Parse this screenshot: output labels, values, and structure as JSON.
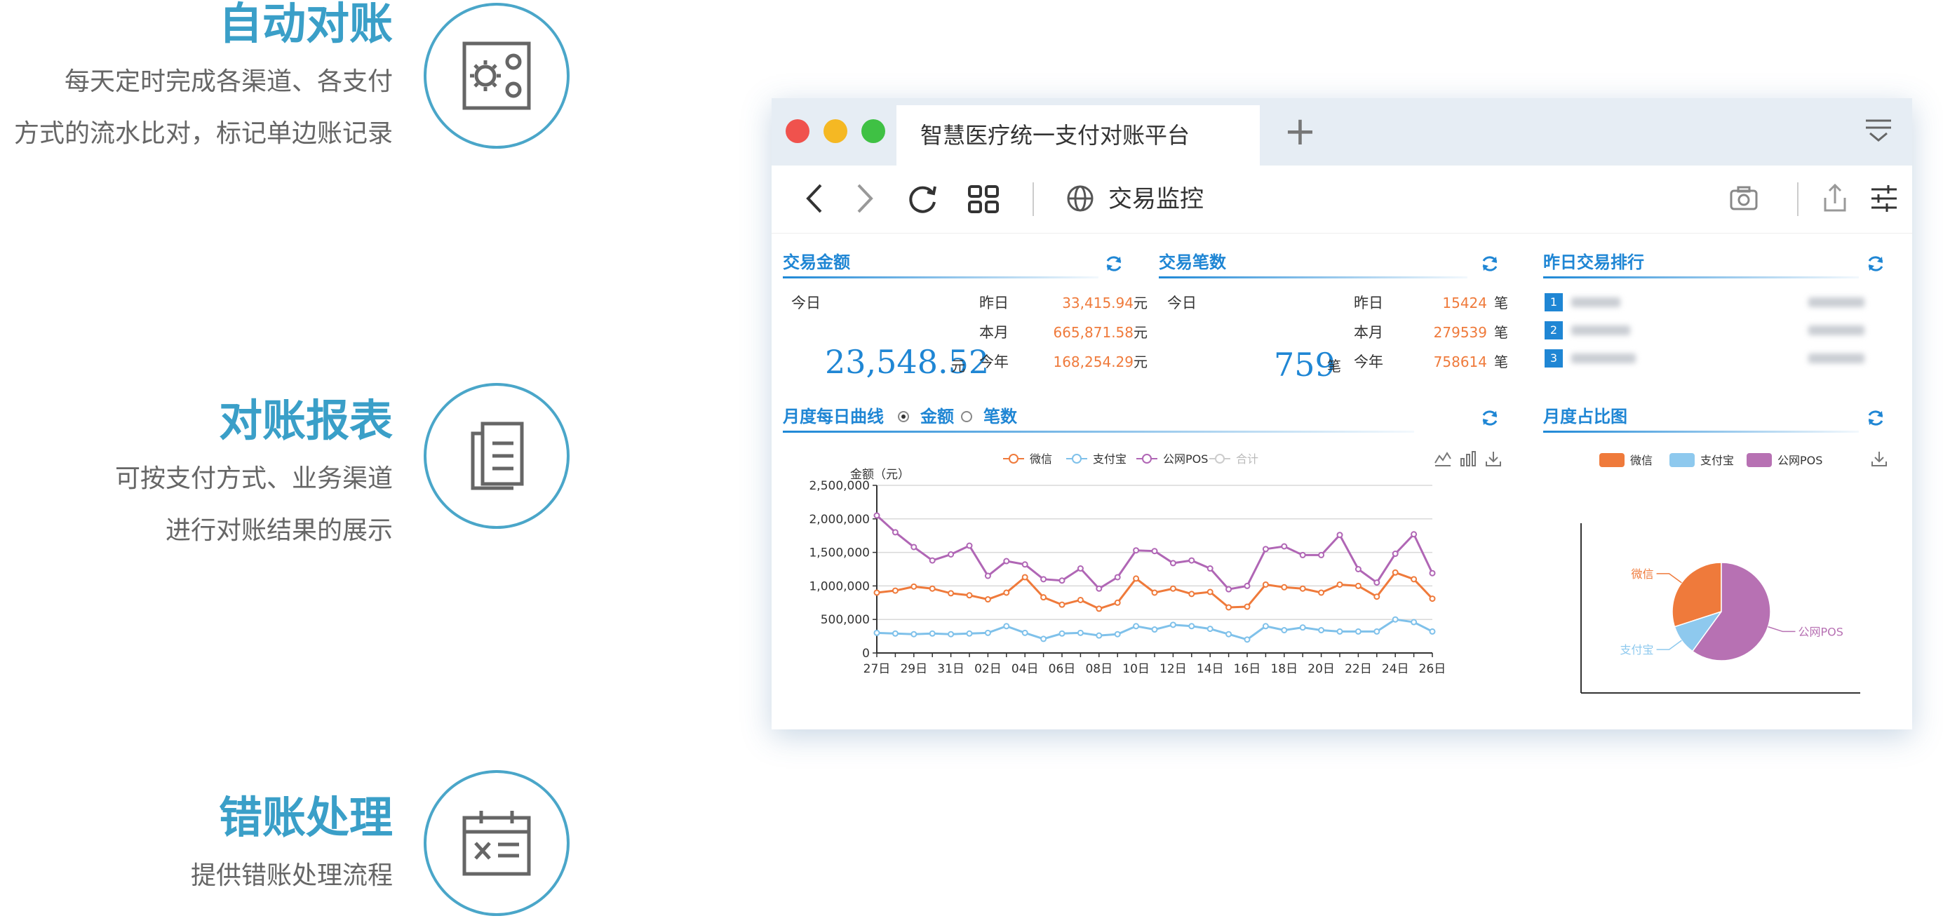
{
  "features": [
    {
      "title": "自动对账",
      "lines": [
        "每天定时完成各渠道、各支付",
        "方式的流水比对，标记单边账记录"
      ],
      "icon": "settings-panel-icon"
    },
    {
      "title": "对账报表",
      "lines": [
        "可按支付方式、业务渠道",
        "进行对账结果的展示"
      ],
      "icon": "document-icon"
    },
    {
      "title": "错账处理",
      "lines": [
        "提供错账处理流程"
      ],
      "icon": "calendar-x-icon"
    }
  ],
  "browser": {
    "tab_title": "智慧医疗统一支付对账平台",
    "new_tab": "+",
    "address": "交易监控",
    "colors": {
      "close": "#f0524d",
      "minimize": "#f5b823",
      "maximize": "#3fc144"
    }
  },
  "amount_panel": {
    "title": "交易金额",
    "today_label": "今日",
    "today_value": "23,548.52",
    "today_unit": "元",
    "rows": [
      {
        "label": "昨日",
        "value": "33,415.94",
        "unit": "元"
      },
      {
        "label": "本月",
        "value": "665,871.58",
        "unit": "元"
      },
      {
        "label": "今年",
        "value": "168,254.29",
        "unit": "元"
      }
    ]
  },
  "count_panel": {
    "title": "交易笔数",
    "today_label": "今日",
    "today_value": "759",
    "today_unit": "笔",
    "rows": [
      {
        "label": "昨日",
        "value": "15424",
        "unit": "笔"
      },
      {
        "label": "本月",
        "value": "279539",
        "unit": "笔"
      },
      {
        "label": "今年",
        "value": "758614",
        "unit": "笔"
      }
    ]
  },
  "ranking_panel": {
    "title": "昨日交易排行",
    "ranks": [
      "1",
      "2",
      "3"
    ]
  },
  "line_panel": {
    "title": "月度每日曲线",
    "radio_amount": "金额",
    "radio_count": "笔数",
    "selected": "金额"
  },
  "pie_panel": {
    "title": "月度占比图"
  },
  "chart_data": [
    {
      "type": "line",
      "ylabel": "金额（元）",
      "ylim": [
        0,
        2500000
      ],
      "yticks": [
        "0",
        "500,000",
        "1,000,000",
        "1,500,000",
        "2,000,000",
        "2,500,000"
      ],
      "x": [
        "27日",
        "28日",
        "29日",
        "30日",
        "31日",
        "01日",
        "02日",
        "03日",
        "04日",
        "05日",
        "06日",
        "07日",
        "08日",
        "09日",
        "10日",
        "11日",
        "12日",
        "13日",
        "14日",
        "15日",
        "16日",
        "17日",
        "18日",
        "19日",
        "20日",
        "21日",
        "22日",
        "23日",
        "24日",
        "25日",
        "26日"
      ],
      "xtick_labels": [
        "27日",
        "29日",
        "31日",
        "02日",
        "04日",
        "06日",
        "08日",
        "10日",
        "12日",
        "14日",
        "16日",
        "18日",
        "20日",
        "22日",
        "24日",
        "26日"
      ],
      "legend": [
        "微信",
        "支付宝",
        "公网POS",
        "合计"
      ],
      "series": [
        {
          "name": "微信",
          "color": "#ef7a3b",
          "values": [
            900000,
            930000,
            990000,
            960000,
            890000,
            860000,
            800000,
            900000,
            1130000,
            830000,
            720000,
            790000,
            660000,
            750000,
            1110000,
            900000,
            960000,
            880000,
            910000,
            680000,
            690000,
            1020000,
            980000,
            960000,
            900000,
            1020000,
            1000000,
            840000,
            1200000,
            1100000,
            810000
          ]
        },
        {
          "name": "支付宝",
          "color": "#7fc1ea",
          "values": [
            300000,
            290000,
            280000,
            290000,
            280000,
            290000,
            300000,
            400000,
            300000,
            210000,
            290000,
            300000,
            260000,
            280000,
            400000,
            350000,
            420000,
            400000,
            360000,
            280000,
            200000,
            400000,
            340000,
            380000,
            340000,
            320000,
            320000,
            320000,
            500000,
            460000,
            320000
          ]
        },
        {
          "name": "公网POS",
          "color": "#b066b5",
          "values": [
            2050000,
            1800000,
            1580000,
            1380000,
            1470000,
            1600000,
            1150000,
            1370000,
            1320000,
            1100000,
            1080000,
            1260000,
            960000,
            1130000,
            1530000,
            1520000,
            1340000,
            1380000,
            1260000,
            950000,
            1000000,
            1550000,
            1590000,
            1460000,
            1460000,
            1760000,
            1250000,
            1050000,
            1480000,
            1770000,
            1190000
          ]
        },
        {
          "name": "合计",
          "color": "#cccccc",
          "values": []
        }
      ]
    },
    {
      "type": "pie",
      "legend": [
        "微信",
        "支付宝",
        "公网POS"
      ],
      "slices": [
        {
          "name": "微信",
          "value": 30,
          "color": "#ef7a3b"
        },
        {
          "name": "支付宝",
          "value": 10,
          "color": "#8ec9ee"
        },
        {
          "name": "公网POS",
          "value": 60,
          "color": "#b771b3"
        }
      ]
    }
  ]
}
